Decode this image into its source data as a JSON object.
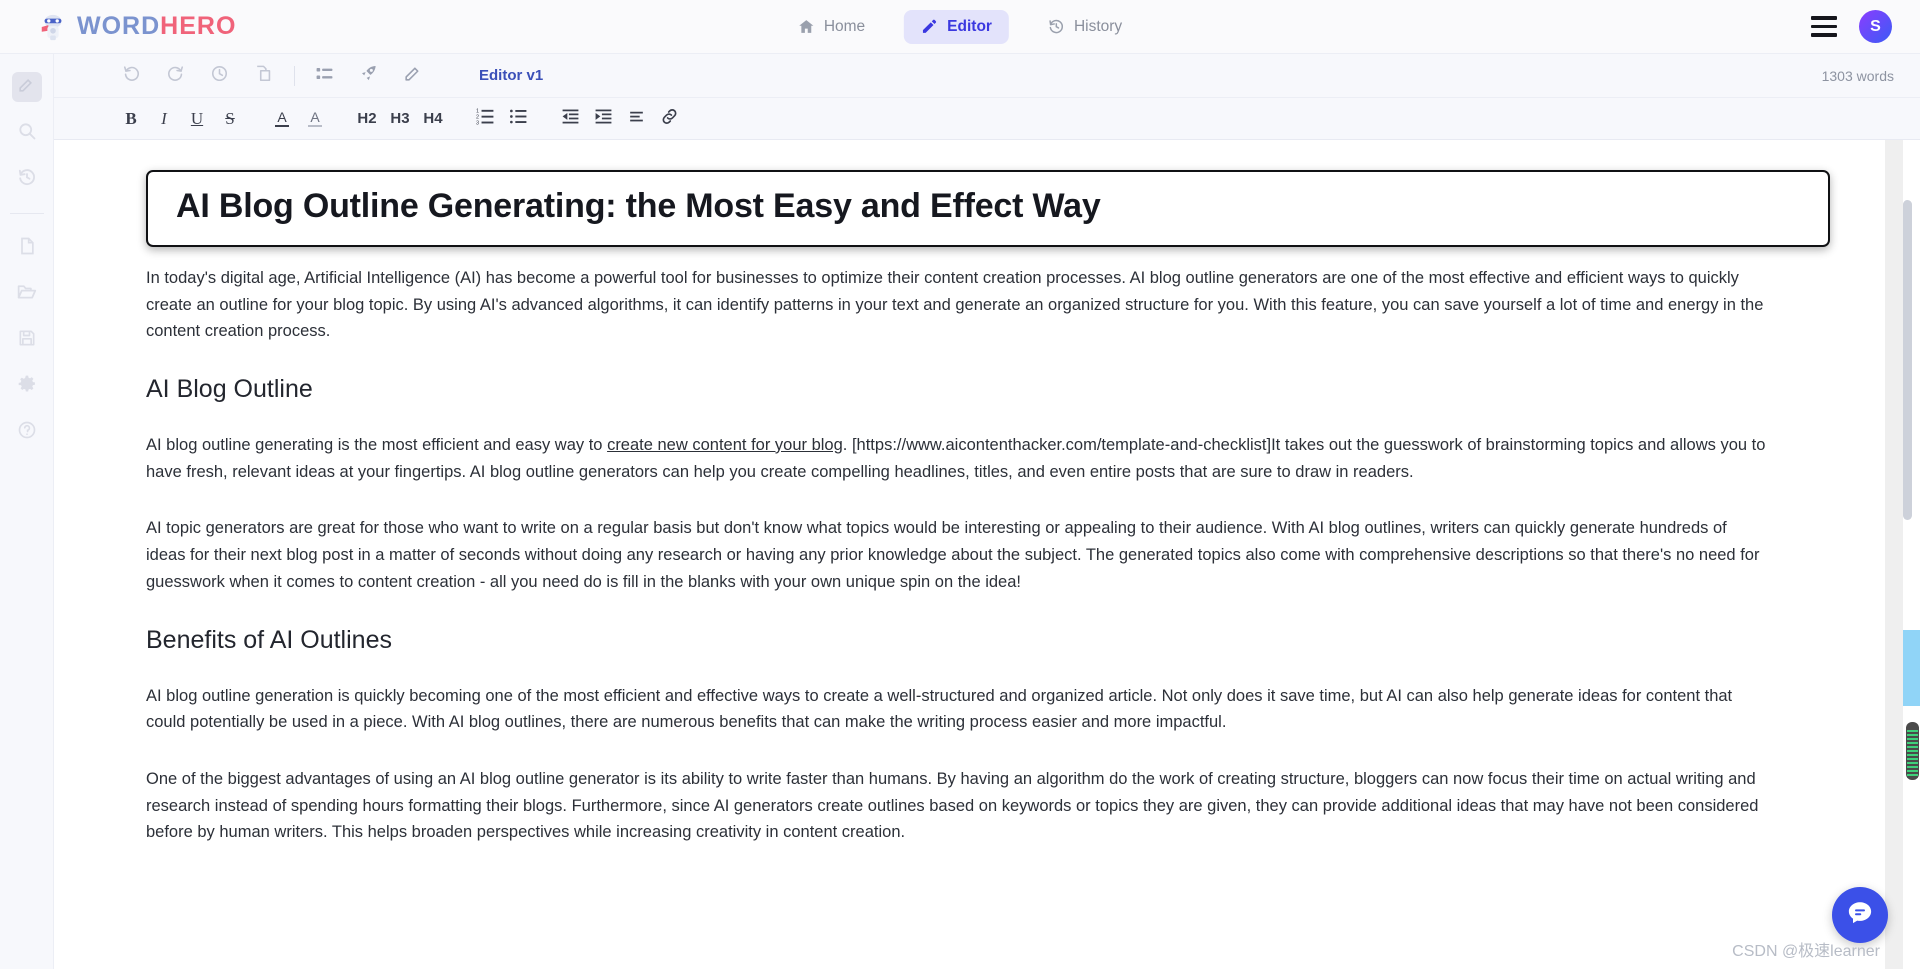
{
  "brand": {
    "word": "WORD",
    "hero": "HERO",
    "logo_icon": "robot-hero-logo"
  },
  "topnav": {
    "items": [
      {
        "label": "Home",
        "icon": "home-icon",
        "active": false
      },
      {
        "label": "Editor",
        "icon": "pencil-icon",
        "active": true
      },
      {
        "label": "History",
        "icon": "history-icon",
        "active": false
      }
    ],
    "menu_icon": "hamburger-menu-icon",
    "avatar_initial": "S",
    "colors": {
      "active_bg": "#e3e3fb",
      "active_text": "#3b38e0",
      "avatar_gradient_start": "#8b3dff",
      "avatar_gradient_end": "#3b5bf5"
    }
  },
  "rail": {
    "items": [
      {
        "icon": "edit-pencil-icon",
        "name": "rail-edit",
        "selected": true
      },
      {
        "icon": "search-icon",
        "name": "rail-search",
        "selected": false
      },
      {
        "icon": "history-revert-icon",
        "name": "rail-history",
        "selected": false
      },
      {
        "icon": "new-document-icon",
        "name": "rail-new-document",
        "selected": false
      },
      {
        "icon": "open-folder-icon",
        "name": "rail-open",
        "selected": false
      },
      {
        "icon": "save-floppy-icon",
        "name": "rail-save",
        "selected": false
      },
      {
        "icon": "gear-icon",
        "name": "rail-settings",
        "selected": false
      },
      {
        "icon": "help-question-icon",
        "name": "rail-help",
        "selected": false
      }
    ]
  },
  "toolbar": {
    "buttons": [
      {
        "icon": "undo-icon",
        "name": "undo-button"
      },
      {
        "icon": "redo-icon",
        "name": "redo-button"
      },
      {
        "icon": "clock-icon",
        "name": "history-button"
      },
      {
        "icon": "copy-icon",
        "name": "duplicate-button"
      },
      {
        "icon": "list-icon",
        "name": "outline-button"
      },
      {
        "icon": "rocket-icon",
        "name": "boost-button"
      },
      {
        "icon": "pencil-icon",
        "name": "rewrite-button"
      }
    ],
    "editor_version": "Editor v1",
    "word_count": "1303 words"
  },
  "format_toolbar": {
    "buttons": [
      {
        "label": "B",
        "name": "bold-button",
        "icon": "bold-icon"
      },
      {
        "label": "I",
        "name": "italic-button",
        "icon": "italic-icon"
      },
      {
        "label": "U",
        "name": "underline-button",
        "icon": "underline-icon"
      },
      {
        "label": "S",
        "name": "strikethrough-button",
        "icon": "strikethrough-icon"
      },
      {
        "label": "A",
        "name": "text-color-button",
        "icon": "text-color-icon"
      },
      {
        "label": "A",
        "name": "highlight-color-button",
        "icon": "highlight-icon"
      },
      {
        "label": "H2",
        "name": "heading-2-button",
        "icon": "h2-icon"
      },
      {
        "label": "H3",
        "name": "heading-3-button",
        "icon": "h3-icon"
      },
      {
        "label": "H4",
        "name": "heading-4-button",
        "icon": "h4-icon"
      },
      {
        "label": "",
        "name": "ordered-list-button",
        "icon": "ordered-list-icon"
      },
      {
        "label": "",
        "name": "bullet-list-button",
        "icon": "bullet-list-icon"
      },
      {
        "label": "",
        "name": "outdent-button",
        "icon": "outdent-icon"
      },
      {
        "label": "",
        "name": "indent-button",
        "icon": "indent-icon"
      },
      {
        "label": "",
        "name": "align-button",
        "icon": "align-icon"
      },
      {
        "label": "",
        "name": "link-button",
        "icon": "link-icon"
      }
    ]
  },
  "document": {
    "title": "AI Blog Outline Generating: the Most Easy and Effect Way",
    "blocks": [
      {
        "type": "paragraph",
        "text": "In today's digital age, Artificial Intelligence (AI) has become a powerful tool for businesses to optimize their content creation processes. AI blog outline generators are one of the most effective and efficient ways to quickly create an outline for your blog topic. By using AI's advanced algorithms, it can identify patterns in your text and generate an organized structure for you. With this feature, you can save yourself a lot of time and energy in the content creation process."
      },
      {
        "type": "heading",
        "text": "AI Blog Outline"
      },
      {
        "type": "paragraph_with_link",
        "before": "AI blog outline generating is the most efficient and easy way to ",
        "link": "create new content for your blog",
        "after": ". [https://www.aicontenthacker.com/template-and-checklist]It takes out the guesswork of brainstorming topics and allows you to have fresh, relevant ideas at your fingertips. AI blog outline generators can help you create compelling headlines, titles, and even entire posts that are sure to draw in readers."
      },
      {
        "type": "paragraph",
        "text": "AI topic generators are great for those who want to write on a regular basis but don't know what topics would be interesting or appealing to their audience. With AI blog outlines, writers can quickly generate hundreds of ideas for their next blog post in a matter of seconds without doing any research or having any prior knowledge about the subject. The generated topics also come with comprehensive descriptions so that there's no need for guesswork when it comes to content creation - all you need do is fill in the blanks with your own unique spin on the idea!"
      },
      {
        "type": "heading",
        "text": "Benefits of AI Outlines"
      },
      {
        "type": "paragraph",
        "text": "AI blog outline generation is quickly becoming one of the most efficient and effective ways to create a well-structured and organized article. Not only does it save time, but AI can also help generate ideas for content that could potentially be used in a piece. With AI blog outlines, there are numerous benefits that can make the writing process easier and more impactful."
      },
      {
        "type": "paragraph",
        "text": "One of the biggest advantages of using an AI blog outline generator is its ability to write faster than humans. By having an algorithm do the work of creating structure, bloggers can now focus their time on actual writing and research instead of spending hours formatting their blogs. Furthermore, since AI generators create outlines based on keywords or topics they are given, they can provide additional ideas that may have not been considered before by human writers. This helps broaden perspectives while increasing creativity in content creation."
      }
    ]
  },
  "overlays": {
    "chat_icon": "chat-bubble-icon",
    "watermark": "CSDN @极速learner"
  }
}
